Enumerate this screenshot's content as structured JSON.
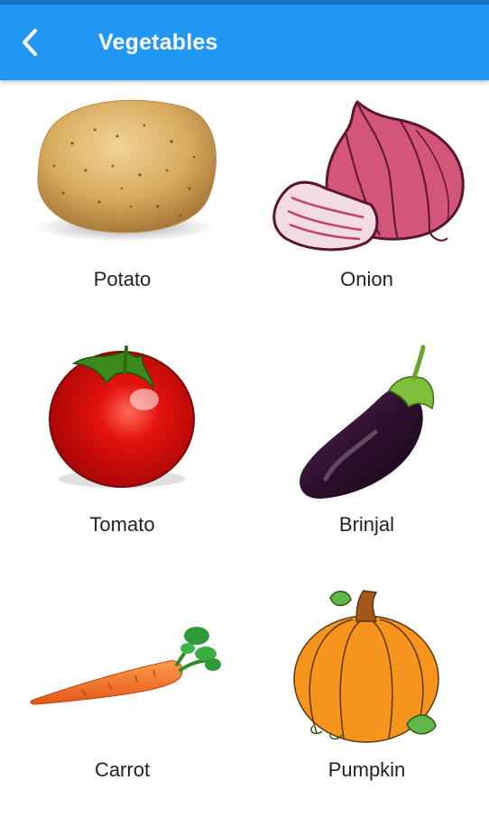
{
  "app_bar": {
    "title": "Vegetables",
    "back_icon": "chevron-left-icon",
    "background_color": "#2196f3",
    "title_color": "#ffffff"
  },
  "vegetables": [
    {
      "label": "Potato",
      "icon": "potato-image"
    },
    {
      "label": "Onion",
      "icon": "onion-image"
    },
    {
      "label": "Tomato",
      "icon": "tomato-image"
    },
    {
      "label": "Brinjal",
      "icon": "brinjal-image"
    },
    {
      "label": "Carrot",
      "icon": "carrot-image"
    },
    {
      "label": "Pumpkin",
      "icon": "pumpkin-image"
    }
  ]
}
